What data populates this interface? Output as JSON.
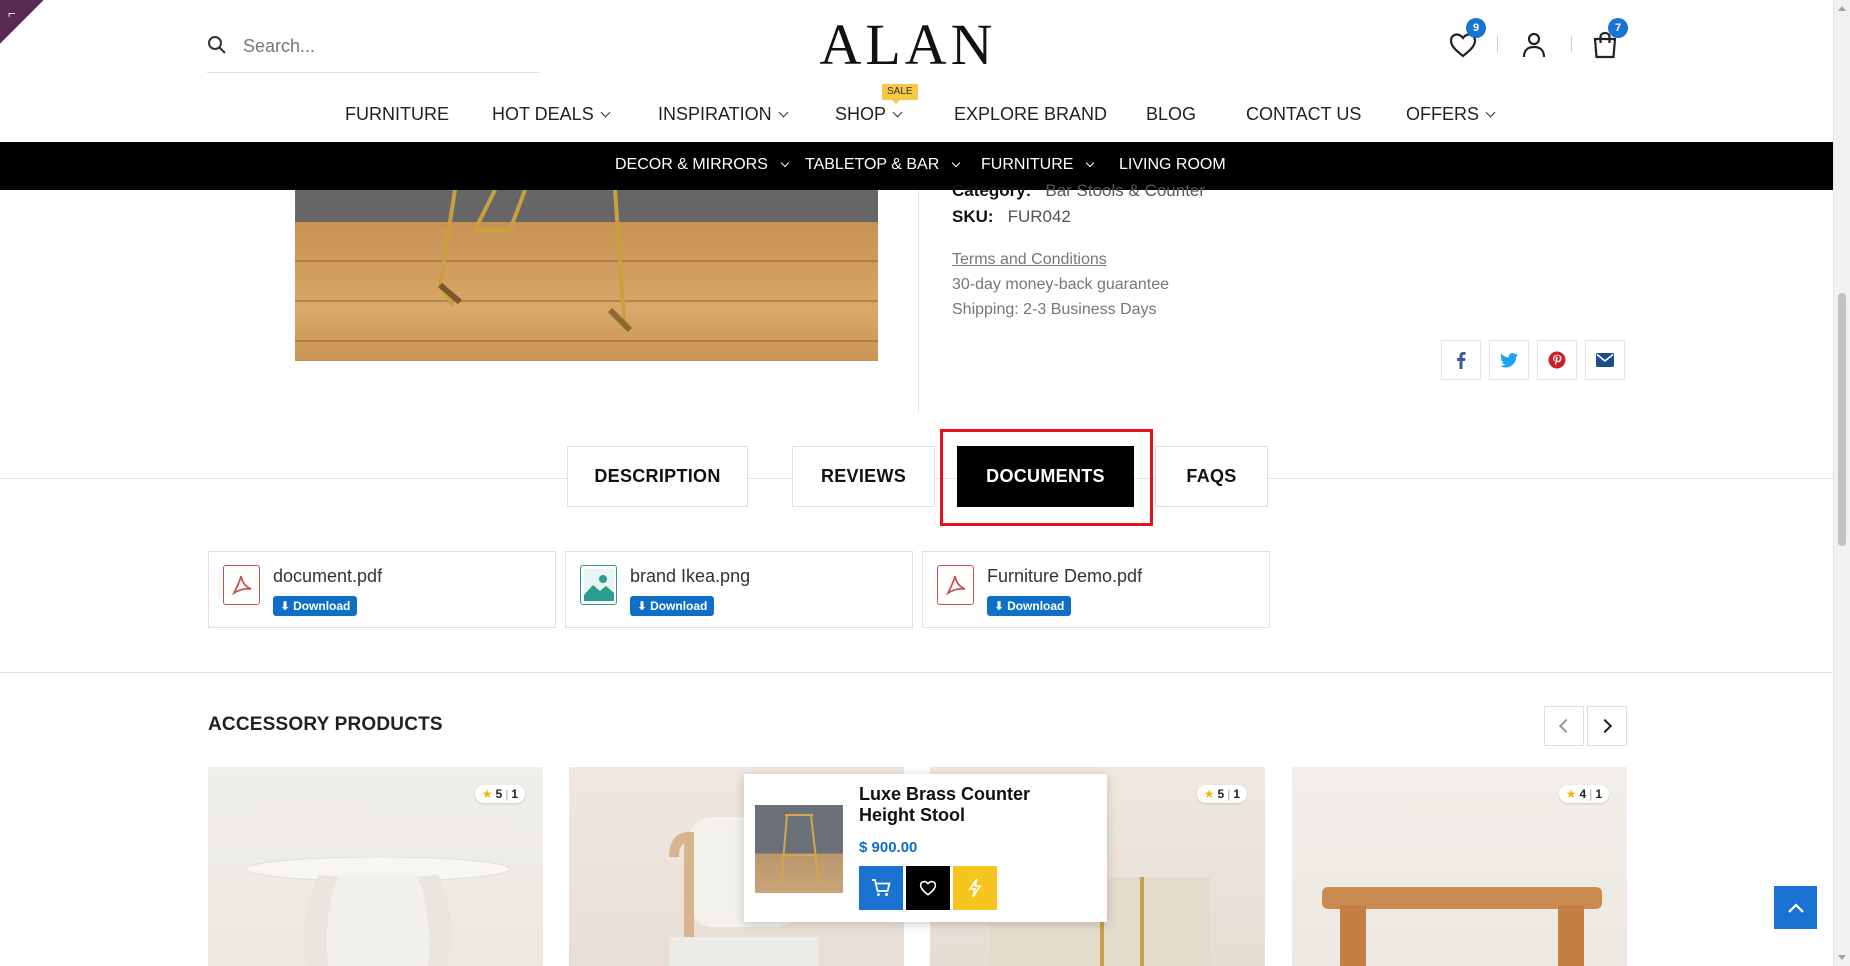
{
  "header": {
    "search_placeholder": "Search...",
    "logo": "ALAN",
    "wishlist_count": "9",
    "cart_count": "7"
  },
  "main_nav": [
    {
      "label": "FURNITURE"
    },
    {
      "label": "HOT DEALS"
    },
    {
      "label": "INSPIRATION"
    },
    {
      "label": "SHOP"
    },
    {
      "label": "EXPLORE BRAND"
    },
    {
      "label": "BLOG"
    },
    {
      "label": "CONTACT US"
    },
    {
      "label": "OFFERS"
    }
  ],
  "sale_badge": "SALE",
  "category_bar": [
    {
      "label": "DECOR & MIRRORS"
    },
    {
      "label": "TABLETOP & BAR"
    },
    {
      "label": "FURNITURE"
    },
    {
      "label": "LIVING ROOM"
    }
  ],
  "product": {
    "category_label": "Category:",
    "category_value": "Bar Stools & Counter",
    "sku_label": "SKU:",
    "sku_value": "FUR042",
    "terms": "Terms and Conditions",
    "guarantee": "30-day money-back guarantee",
    "shipping": "Shipping: 2-3 Business Days"
  },
  "share_icons": [
    "facebook-icon",
    "twitter-icon",
    "pinterest-icon",
    "email-icon"
  ],
  "tabs": [
    {
      "label": "DESCRIPTION"
    },
    {
      "label": "REVIEWS"
    },
    {
      "label": "DOCUMENTS",
      "active": true
    },
    {
      "label": "FAQS"
    }
  ],
  "documents": [
    {
      "name": "document.pdf",
      "type": "pdf",
      "action": "Download"
    },
    {
      "name": "brand Ikea.png",
      "type": "image",
      "action": "Download"
    },
    {
      "name": "Furniture Demo.pdf",
      "type": "pdf",
      "action": "Download"
    }
  ],
  "accessory": {
    "title": "ACCESSORY PRODUCTS",
    "cards": [
      {
        "rating": "5",
        "count": "1"
      },
      {
        "rating": "",
        "count": ""
      },
      {
        "rating": "5",
        "count": "1"
      },
      {
        "rating": "4",
        "count": "1"
      }
    ]
  },
  "popup": {
    "title": "Luxe Brass Counter Height Stool",
    "price": "$ 900.00"
  },
  "colors": {
    "accent": "#1a73d1",
    "price": "#0f6fc6",
    "highlight": "#e8111b",
    "buy_now": "#f6c520",
    "sale": "#f6c945"
  }
}
